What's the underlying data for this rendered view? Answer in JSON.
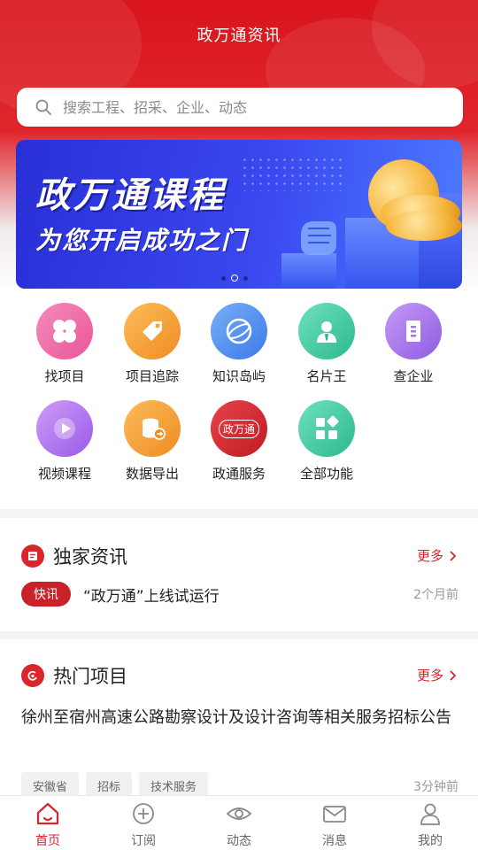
{
  "header": {
    "title": "政万通资讯"
  },
  "search": {
    "placeholder": "搜索工程、招采、企业、动态"
  },
  "banner": {
    "title": "政万通课程",
    "subtitle": "为您开启成功之门",
    "page_count": 3,
    "active_index": 1
  },
  "functions": [
    {
      "label": "找项目",
      "icon": "clover-icon",
      "color": "#ef6aa6"
    },
    {
      "label": "项目追踪",
      "icon": "tag-icon",
      "color": "#f5a13a"
    },
    {
      "label": "知识岛屿",
      "icon": "globe-icon",
      "color": "#4f8df2"
    },
    {
      "label": "名片王",
      "icon": "person-icon",
      "color": "#3cc9a1"
    },
    {
      "label": "查企业",
      "icon": "building-icon",
      "color": "#a975e8"
    },
    {
      "label": "视频课程",
      "icon": "play-icon",
      "color": "#b06ef0"
    },
    {
      "label": "数据导出",
      "icon": "database-export-icon",
      "color": "#f4a33c"
    },
    {
      "label": "政通服务",
      "icon": "brand-badge-icon",
      "color": "#d9252b",
      "badge_text": "政万通"
    },
    {
      "label": "全部功能",
      "icon": "grid-icon",
      "color": "#3cc9a1"
    }
  ],
  "exclusive": {
    "title": "独家资讯",
    "more": "更多",
    "items": [
      {
        "tag": "快讯",
        "text": "“政万通”上线试运行",
        "time": "2个月前"
      }
    ]
  },
  "hot": {
    "title": "热门项目",
    "more": "更多",
    "items": [
      {
        "title": "徐州至宿州高速公路勘察设计及设计咨询等相关服务招标公告",
        "tags": [
          "安徽省",
          "招标",
          "技术服务"
        ],
        "time": "3分钟前"
      }
    ]
  },
  "tabbar": [
    {
      "label": "首页",
      "icon": "home-icon",
      "active": true
    },
    {
      "label": "订阅",
      "icon": "plus-circle-icon",
      "active": false
    },
    {
      "label": "动态",
      "icon": "eye-icon",
      "active": false
    },
    {
      "label": "消息",
      "icon": "mail-icon",
      "active": false
    },
    {
      "label": "我的",
      "icon": "user-icon",
      "active": false
    }
  ],
  "colors": {
    "brand_red": "#d9252b",
    "banner_blue": "#3a48f0"
  }
}
